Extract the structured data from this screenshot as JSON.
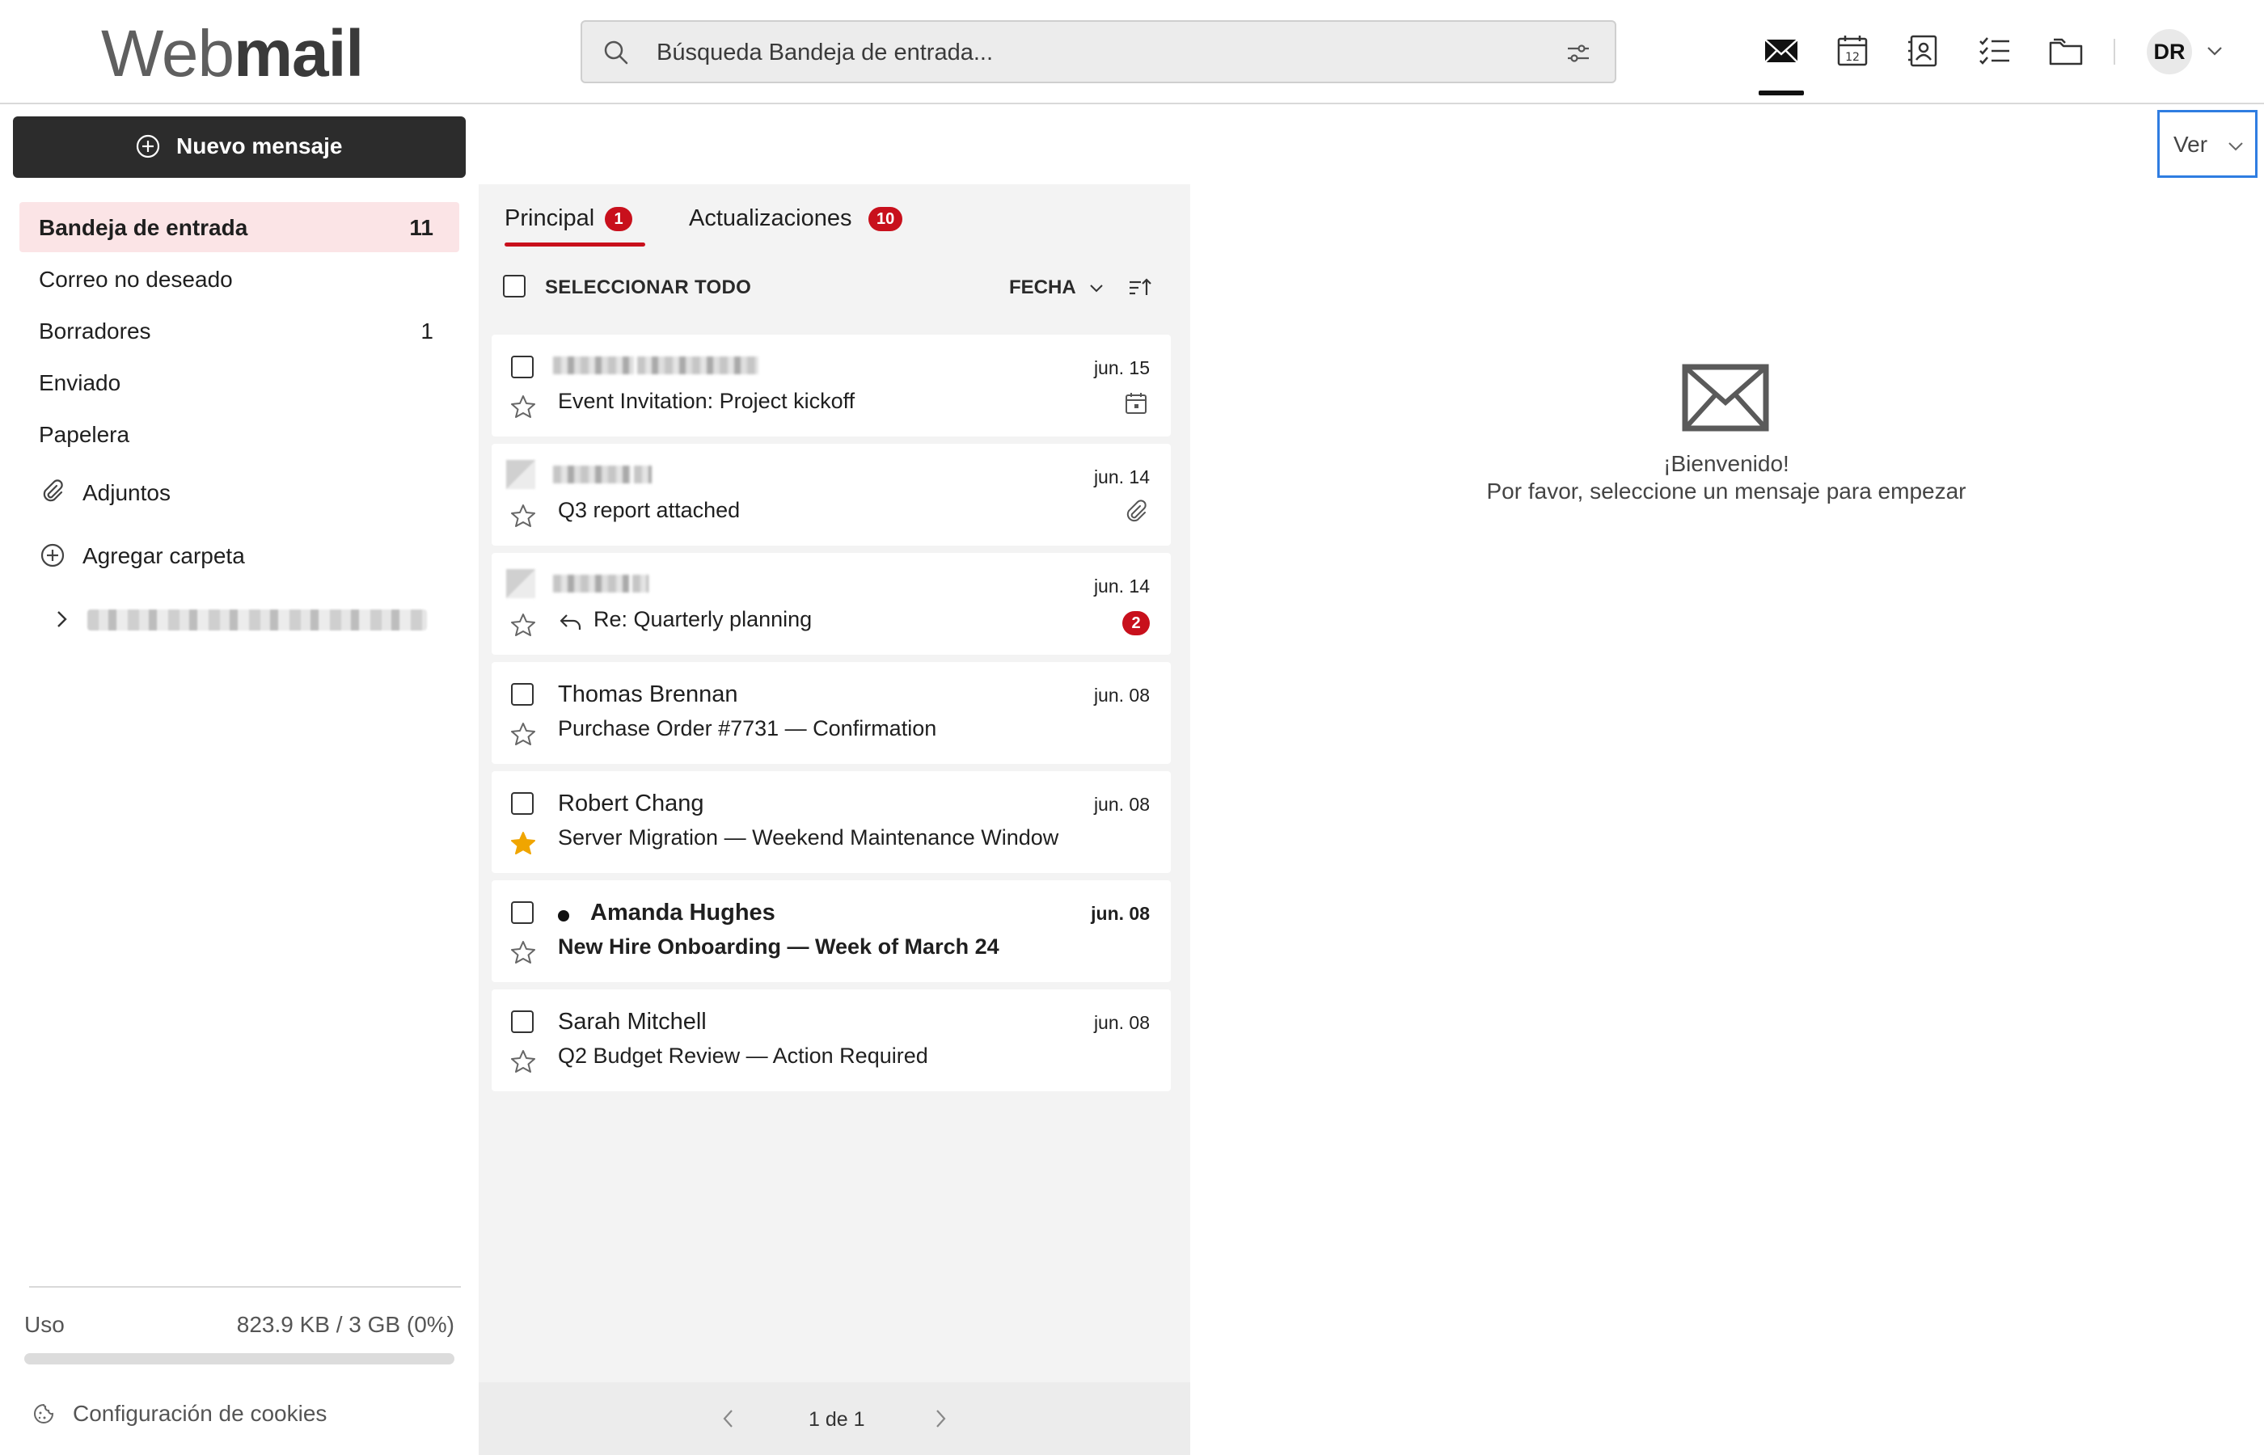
{
  "header": {
    "logo_part1": "Web",
    "logo_part2": "mail",
    "search_placeholder": "Búsqueda Bandeja de entrada...",
    "apps": [
      "mail-icon",
      "calendar-icon",
      "contacts-icon",
      "tasks-icon",
      "files-icon"
    ],
    "calendar_day": "12",
    "avatar_initials": "DR"
  },
  "sidebar": {
    "new_message": "Nuevo mensaje",
    "folders": [
      {
        "name": "Bandeja de entrada",
        "count": "11"
      },
      {
        "name": "Correo no deseado",
        "count": ""
      },
      {
        "name": "Borradores",
        "count": "1"
      },
      {
        "name": "Enviado",
        "count": ""
      },
      {
        "name": "Papelera",
        "count": ""
      }
    ],
    "attachments": "Adjuntos",
    "add_folder": "Agregar carpeta",
    "storage_label": "Uso",
    "storage_value": "823.9 KB / 3 GB (0%)",
    "storage_fraction": 0.0,
    "cookies": "Configuración de cookies"
  },
  "view_button": "Ver",
  "list": {
    "tabs": [
      {
        "label": "Principal",
        "count": "1"
      },
      {
        "label": "Actualizaciones",
        "count": "10"
      }
    ],
    "select_all": "SELECCIONAR TODO",
    "sort_by": "FECHA",
    "messages": [
      {
        "sender": "",
        "subject": "Event Invitation: Project kickoff",
        "date": "jun. 15",
        "starred": false,
        "unread": false,
        "icon": "calendar-icon"
      },
      {
        "sender": "",
        "subject": "Q3 report attached",
        "date": "jun. 14",
        "starred": false,
        "unread": false,
        "icon": "paperclip-icon"
      },
      {
        "sender": "",
        "subject": "Re: Quarterly planning",
        "date": "jun. 14",
        "starred": false,
        "unread": false,
        "thread_count": "2"
      },
      {
        "sender": "Thomas Brennan",
        "subject": "Purchase Order #7731 — Confirmation",
        "date": "jun. 08",
        "starred": false,
        "unread": false
      },
      {
        "sender": "Robert Chang",
        "subject": "Server Migration — Weekend Maintenance Window",
        "date": "jun. 08",
        "starred": true,
        "unread": false
      },
      {
        "sender": "Amanda Hughes",
        "subject": "New Hire Onboarding — Week of March 24",
        "date": "jun. 08",
        "starred": false,
        "unread": true
      },
      {
        "sender": "Sarah Mitchell",
        "subject": "Q2 Budget Review — Action Required",
        "date": "jun. 08",
        "starred": false,
        "unread": false
      }
    ],
    "pagination": "1 de 1"
  },
  "reading_pane": {
    "welcome_title": "¡Bienvenido!",
    "welcome_subtitle": "Por favor, seleccione un mensaje para empezar"
  },
  "colors": {
    "accent_red": "#c8101c",
    "active_folder_bg": "#fbe4e6",
    "focus_blue": "#2f7de1",
    "star_gold": "#f0a500"
  }
}
